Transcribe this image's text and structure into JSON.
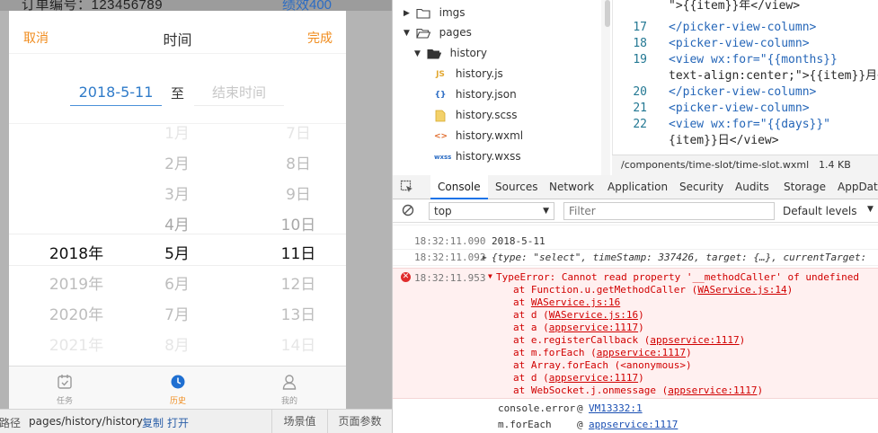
{
  "simulator": {
    "order_label": "订单编号：123456789",
    "perf_label": "绩效400",
    "picker": {
      "cancel": "取消",
      "title": "时间",
      "done": "完成"
    },
    "range": {
      "start": "2018-5-11",
      "separator": "至",
      "end_placeholder": "结束时间"
    },
    "years": [
      "2018年",
      "2019年",
      "2020年",
      "2021年"
    ],
    "months": [
      "1月",
      "2月",
      "3月",
      "4月",
      "5月",
      "6月",
      "7月",
      "8月"
    ],
    "days": [
      "7日",
      "8日",
      "9日",
      "10日",
      "11日",
      "12日",
      "13日",
      "14日"
    ],
    "tabs": [
      {
        "label": "任务",
        "icon": "calendar-check-icon"
      },
      {
        "label": "历史",
        "icon": "clock-icon"
      },
      {
        "label": "我的",
        "icon": "user-icon"
      }
    ],
    "active_tab": "历史",
    "accent": "#f08c1e",
    "link_color": "#2f7bc9",
    "status": {
      "path_label": "路径",
      "path": "pages/history/history",
      "copy": "复制",
      "open": "打开",
      "scene": "场景值",
      "params": "页面参数"
    }
  },
  "file_tree": [
    {
      "name": "imgs",
      "type": "folder",
      "expanded": false
    },
    {
      "name": "pages",
      "type": "folder",
      "expanded": true
    },
    {
      "name": "history",
      "type": "folder",
      "expanded": true
    },
    {
      "name": "history.js",
      "type": "js"
    },
    {
      "name": "history.json",
      "type": "json"
    },
    {
      "name": "history.scss",
      "type": "scss"
    },
    {
      "name": "history.wxml",
      "type": "wxml"
    },
    {
      "name": "history.wxss",
      "type": "wxss"
    }
  ],
  "editor": {
    "lines": [
      {
        "num": "",
        "html": "\">{{item}}年</view>"
      },
      {
        "num": "17",
        "html": "    </picker-view-column>"
      },
      {
        "num": "18",
        "html": "    <picker-view-column>"
      },
      {
        "num": "19",
        "html": "      <view wx:for=\"{{months}}"
      },
      {
        "num": "",
        "html": "text-align:center;\">{{item}}月<"
      },
      {
        "num": "20",
        "html": "    </picker-view-column>"
      },
      {
        "num": "21",
        "html": "    <picker-view-column>"
      },
      {
        "num": "22",
        "html": "      <view wx:for=\"{{days}}\""
      },
      {
        "num": "",
        "html": "{item}}日</view>"
      }
    ],
    "file_path": "/components/time-slot/time-slot.wxml",
    "file_size": "1.4 KB"
  },
  "devtools": {
    "tabs": [
      "Console",
      "Sources",
      "Network",
      "Application",
      "Security",
      "Audits",
      "Storage",
      "AppData"
    ],
    "active_tab": "Console",
    "context": "top",
    "filter_placeholder": "Filter",
    "levels": "Default levels",
    "accent": "#1a73e8"
  },
  "console": {
    "log1": {
      "time": "18:32:11.090",
      "msg": "2018-5-11"
    },
    "log2": {
      "time": "18:32:11.092",
      "msg": "{type: \"select\", timeStamp: 337426, target: {…}, currentTarget:"
    },
    "error": {
      "time": "18:32:11.953",
      "message": "TypeError: Cannot read property '__methodCaller' of undefined",
      "stack": [
        {
          "fn": "at Function.u.getMethodCaller (",
          "loc": "WAService.js:14",
          "end": ")"
        },
        {
          "fn": "at ",
          "loc": "WAService.js:16",
          "end": ""
        },
        {
          "fn": "at d (",
          "loc": "WAService.js:16",
          "end": ")"
        },
        {
          "fn": "at a (",
          "loc": "appservice:1117",
          "end": ")"
        },
        {
          "fn": "at e.registerCallback (",
          "loc": "appservice:1117",
          "end": ")"
        },
        {
          "fn": "at m.forEach (",
          "loc": "appservice:1117",
          "end": ")"
        },
        {
          "fn": "at Array.forEach (<anonymous>)",
          "loc": "",
          "end": ""
        },
        {
          "fn": "at d (",
          "loc": "appservice:1117",
          "end": ")"
        },
        {
          "fn": "at WebSocket.j.onmessage (",
          "loc": "appservice:1117",
          "end": ")"
        }
      ],
      "color": "#d10000"
    },
    "trace": [
      {
        "fn": "console.error",
        "at": "@",
        "loc": "VM13332:1"
      },
      {
        "fn": "m.forEach",
        "at": "@",
        "loc": "appservice:1117"
      }
    ]
  }
}
